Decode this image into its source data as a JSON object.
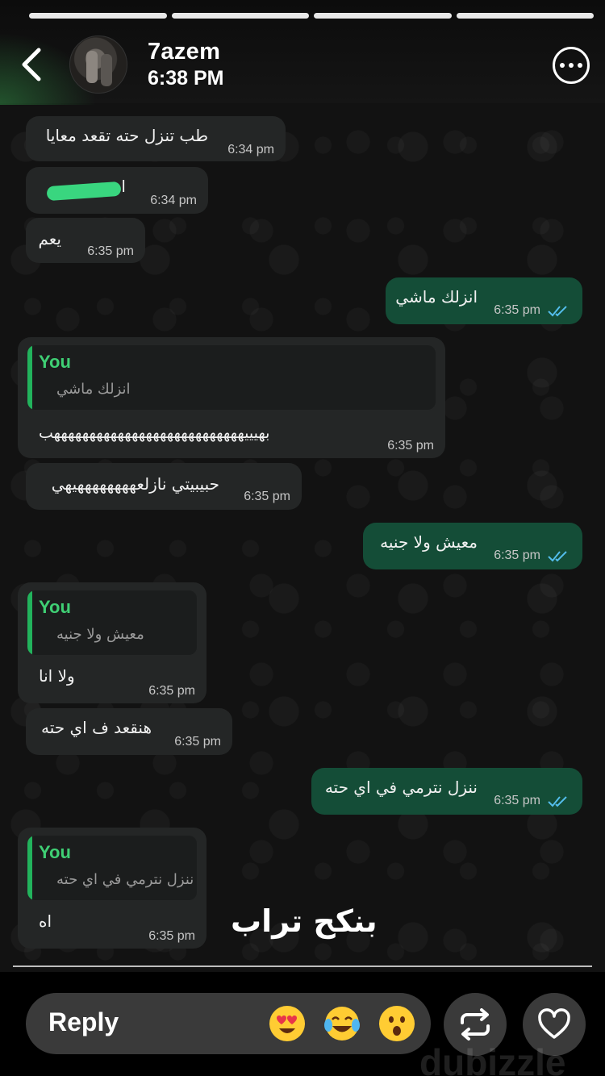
{
  "header": {
    "username": "7azem",
    "time": "6:38 PM"
  },
  "messages": [
    {
      "text": "طب تنزل حته تقعد معايا",
      "time": "6:34 pm"
    },
    {
      "text": "اي",
      "time": "6:34 pm"
    },
    {
      "text": "يعم",
      "time": "6:35 pm"
    },
    {
      "text": "انزلك ماشي",
      "time": "6:35 pm"
    },
    {
      "quote_author": "You",
      "quote_text": "انزلك ماشي",
      "text": "بهيييهههههههههههههههههههههههههههب",
      "time": "6:35 pm"
    },
    {
      "text": "حبيبيتي نازلعههههههههيهي",
      "time": "6:35 pm"
    },
    {
      "text": "معيش ولا جنيه",
      "time": "6:35 pm"
    },
    {
      "quote_author": "You",
      "quote_text": "معيش ولا جنيه",
      "text": "ولا انا",
      "time": "6:35 pm"
    },
    {
      "text": "هنقعد ف اي حته",
      "time": "6:35 pm"
    },
    {
      "text": "ننزل نترمي في اي حته",
      "time": "6:35 pm"
    },
    {
      "quote_author": "You",
      "quote_text": "ننزل نترمي في اي حته",
      "text": "اه",
      "time": "6:35 pm"
    }
  ],
  "caption": "بنكح تراب",
  "reply_bar": {
    "placeholder": "Reply",
    "emojis": [
      "heart-eyes-emoji",
      "tears-of-joy-emoji",
      "surprised-emoji"
    ]
  },
  "watermark": "dubizzle",
  "colors": {
    "incoming_bubble": "#242626",
    "outgoing_bubble": "#144d37",
    "quote_accent": "#22b35c",
    "read_ticks": "#53bdeb"
  }
}
